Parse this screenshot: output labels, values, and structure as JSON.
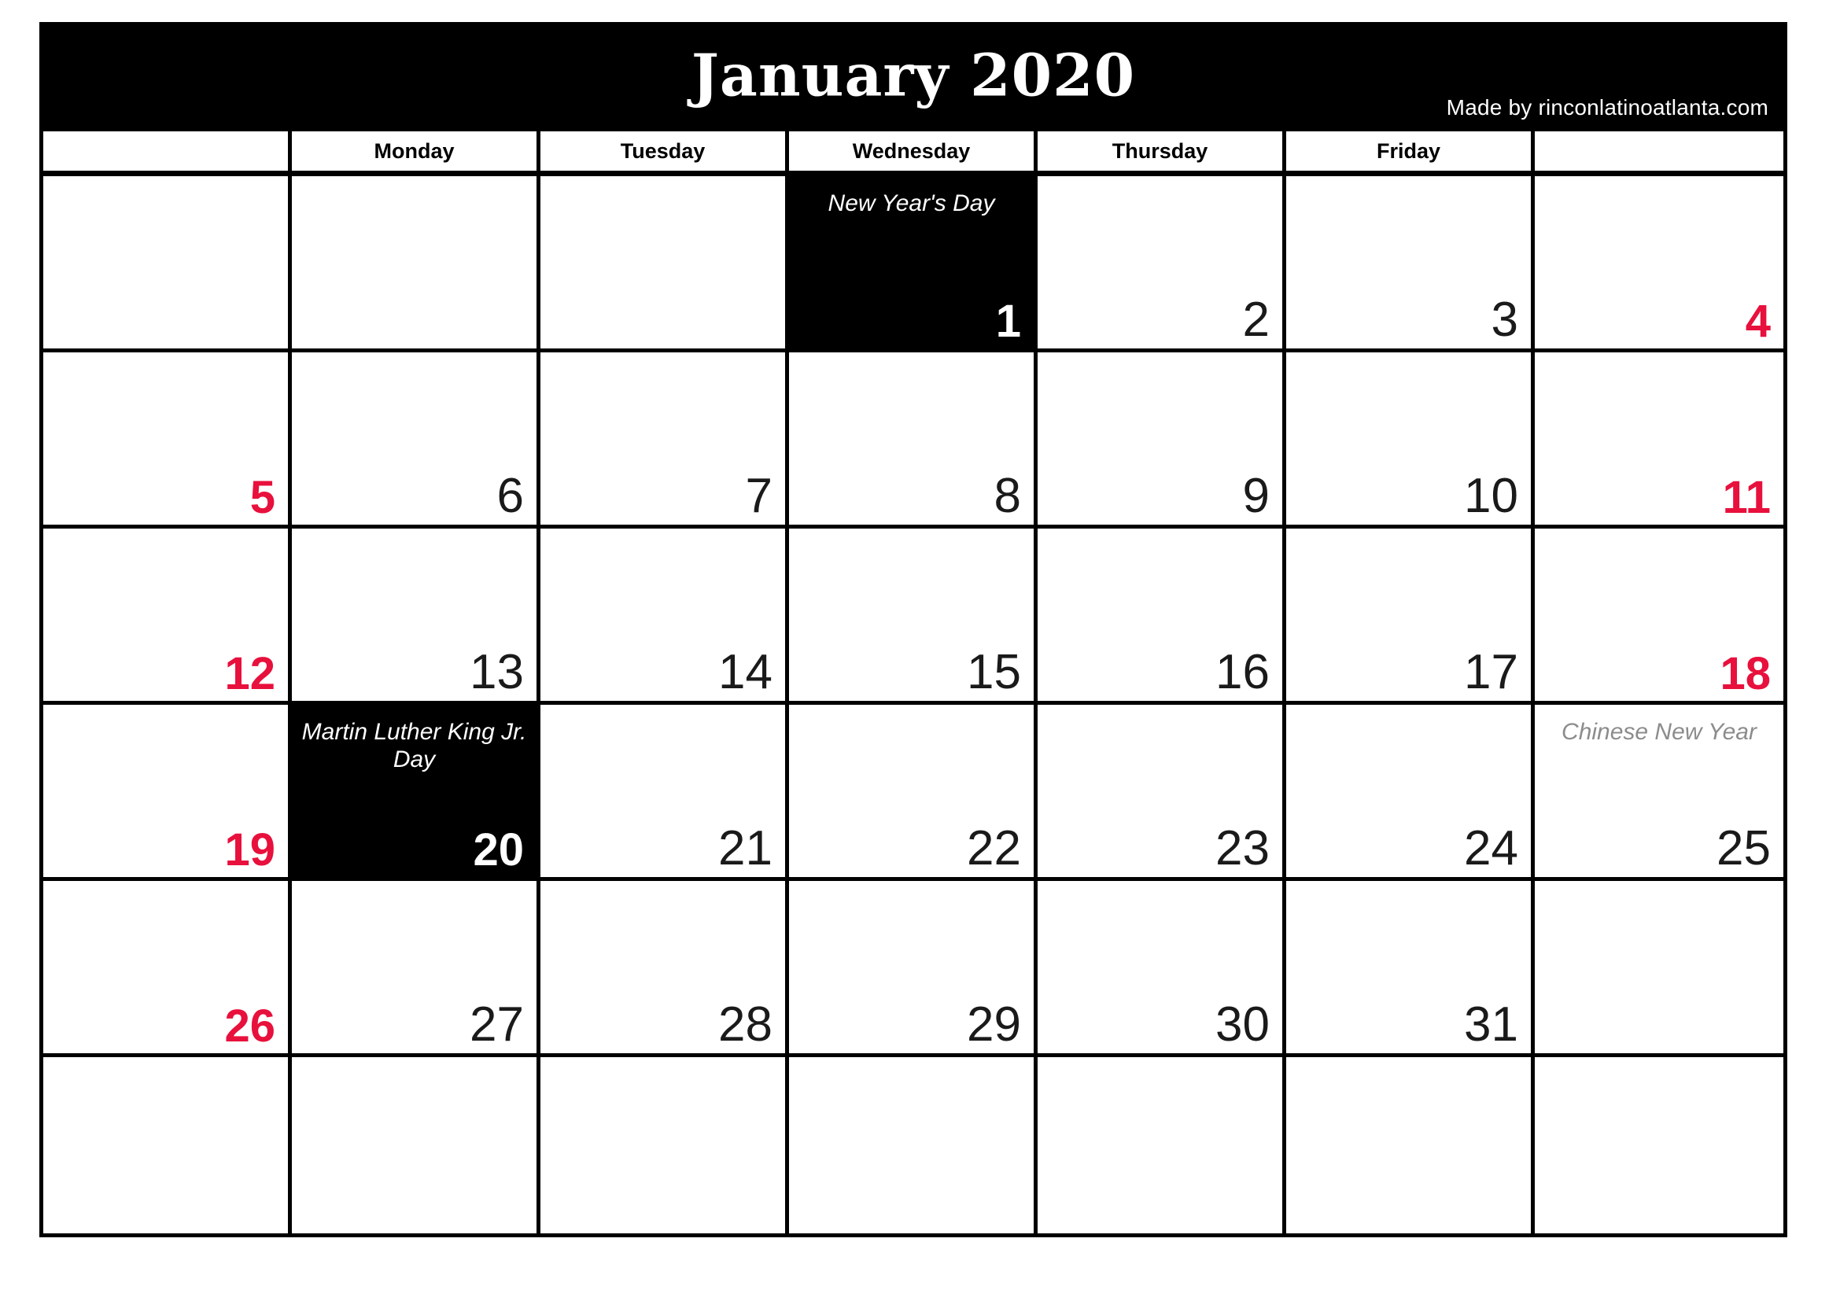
{
  "header": {
    "title": "January 2020",
    "credit": "Made by rinconlatinoatlanta.com",
    "background_color": "#000000",
    "text_color": "#FFFFFF"
  },
  "colors": {
    "weekend_red": "#E8103C",
    "holiday_background": "#000000",
    "muted_event": "#8C8C8C",
    "grid_line": "#000000",
    "cell_background": "#FFFFFF"
  },
  "weekday_headers": [
    "",
    "Monday",
    "Tuesday",
    "Wednesday",
    "Thursday",
    "Friday",
    ""
  ],
  "weeks": [
    [
      {
        "day": "",
        "event": "",
        "style": "empty"
      },
      {
        "day": "",
        "event": "",
        "style": "empty"
      },
      {
        "day": "",
        "event": "",
        "style": "empty"
      },
      {
        "day": "1",
        "event": "New Year's Day",
        "style": "holiday"
      },
      {
        "day": "2",
        "event": "",
        "style": "normal"
      },
      {
        "day": "3",
        "event": "",
        "style": "normal"
      },
      {
        "day": "4",
        "event": "",
        "style": "weekend"
      }
    ],
    [
      {
        "day": "5",
        "event": "",
        "style": "weekend"
      },
      {
        "day": "6",
        "event": "",
        "style": "normal"
      },
      {
        "day": "7",
        "event": "",
        "style": "normal"
      },
      {
        "day": "8",
        "event": "",
        "style": "normal"
      },
      {
        "day": "9",
        "event": "",
        "style": "normal"
      },
      {
        "day": "10",
        "event": "",
        "style": "normal"
      },
      {
        "day": "11",
        "event": "",
        "style": "weekend"
      }
    ],
    [
      {
        "day": "12",
        "event": "",
        "style": "weekend"
      },
      {
        "day": "13",
        "event": "",
        "style": "normal"
      },
      {
        "day": "14",
        "event": "",
        "style": "normal"
      },
      {
        "day": "15",
        "event": "",
        "style": "normal"
      },
      {
        "day": "16",
        "event": "",
        "style": "normal"
      },
      {
        "day": "17",
        "event": "",
        "style": "normal"
      },
      {
        "day": "18",
        "event": "",
        "style": "weekend"
      }
    ],
    [
      {
        "day": "19",
        "event": "",
        "style": "weekend"
      },
      {
        "day": "20",
        "event": "Martin Luther King Jr. Day",
        "style": "holiday"
      },
      {
        "day": "21",
        "event": "",
        "style": "normal"
      },
      {
        "day": "22",
        "event": "",
        "style": "normal"
      },
      {
        "day": "23",
        "event": "",
        "style": "normal"
      },
      {
        "day": "24",
        "event": "",
        "style": "normal"
      },
      {
        "day": "25",
        "event": "Chinese New Year",
        "style": "muted-event"
      }
    ],
    [
      {
        "day": "26",
        "event": "",
        "style": "weekend"
      },
      {
        "day": "27",
        "event": "",
        "style": "normal"
      },
      {
        "day": "28",
        "event": "",
        "style": "normal"
      },
      {
        "day": "29",
        "event": "",
        "style": "normal"
      },
      {
        "day": "30",
        "event": "",
        "style": "normal"
      },
      {
        "day": "31",
        "event": "",
        "style": "normal"
      },
      {
        "day": "",
        "event": "",
        "style": "empty"
      }
    ],
    [
      {
        "day": "",
        "event": "",
        "style": "empty"
      },
      {
        "day": "",
        "event": "",
        "style": "empty"
      },
      {
        "day": "",
        "event": "",
        "style": "empty"
      },
      {
        "day": "",
        "event": "",
        "style": "empty"
      },
      {
        "day": "",
        "event": "",
        "style": "empty"
      },
      {
        "day": "",
        "event": "",
        "style": "empty"
      },
      {
        "day": "",
        "event": "",
        "style": "empty"
      }
    ]
  ]
}
